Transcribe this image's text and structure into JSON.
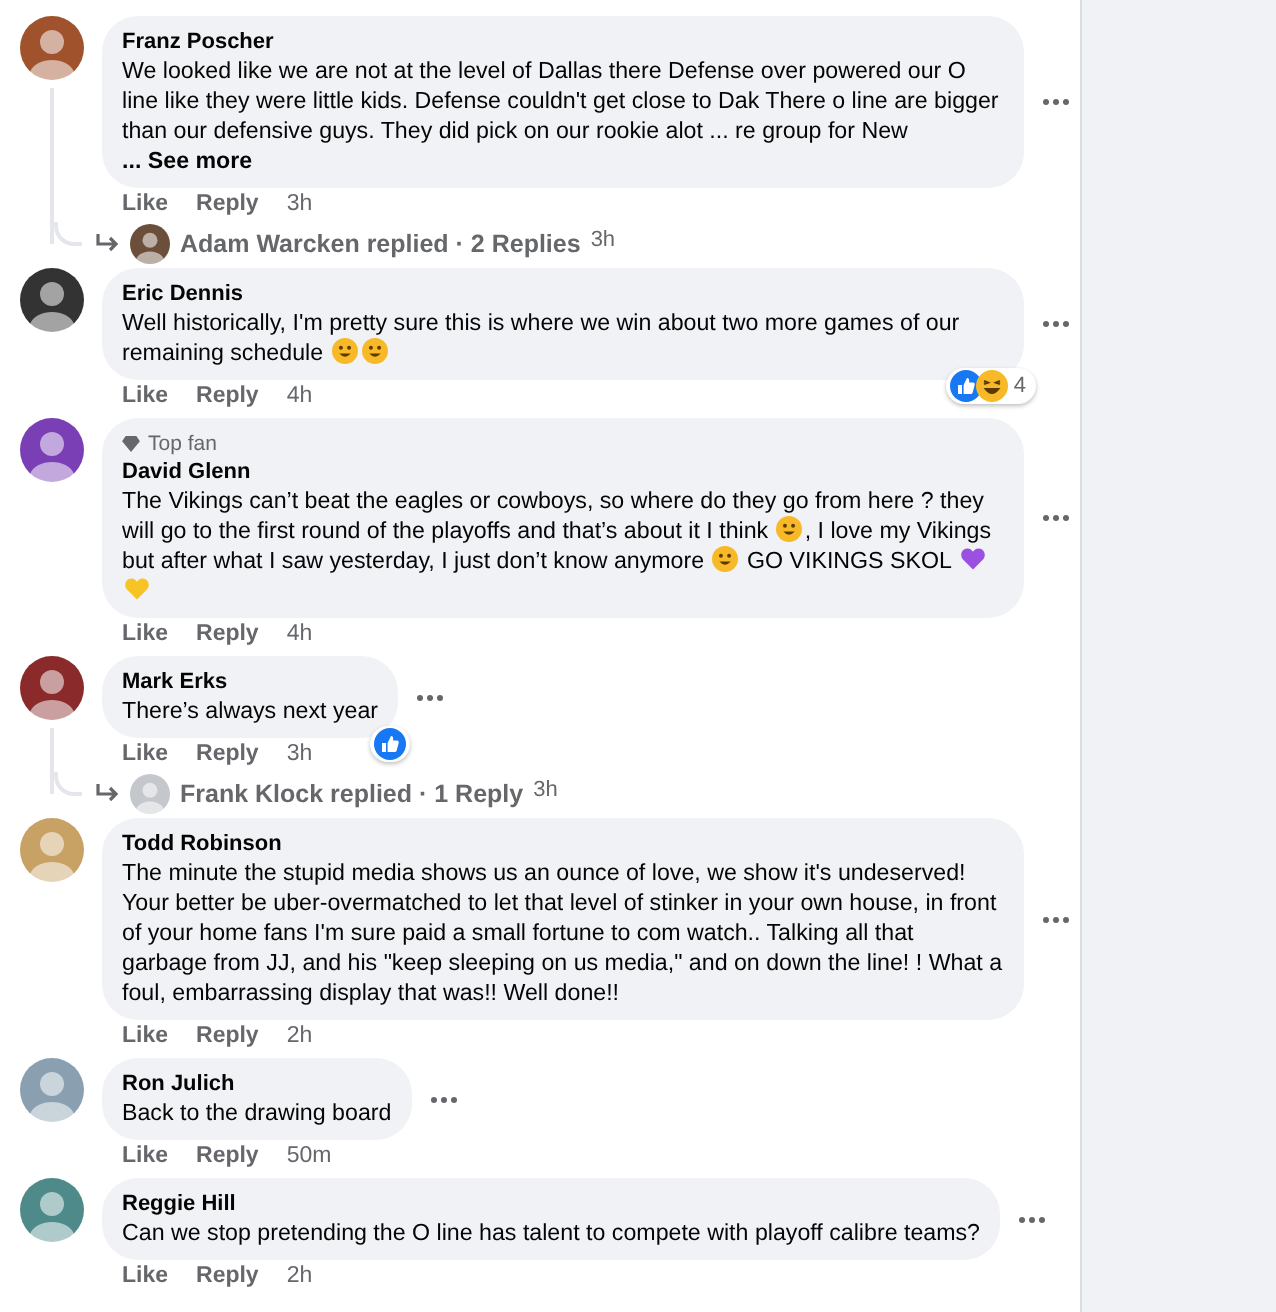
{
  "comments": [
    {
      "author": "Franz Poscher",
      "body": [
        {
          "kind": "text",
          "text": "We looked like we are not at the level of Dallas there Defense over powered our O line like they were little kids. Defense couldn't get close to Dak There o line are bigger than our defensive guys. They did pick on our rookie alot ... re group for New "
        }
      ],
      "see_more": "... See more",
      "actions": [
        "Like",
        "Reply"
      ],
      "time": "3h",
      "replies": {
        "name": "Adam Warcken replied · 2 Replies",
        "time": "3h"
      }
    },
    {
      "author": "Eric Dennis",
      "body": [
        {
          "kind": "text",
          "text": "Well historically, I'm pretty sure this is where we win about two more games of our remaining schedule "
        },
        {
          "kind": "face",
          "color": "#f7b928"
        },
        {
          "kind": "face",
          "color": "#f7b928"
        }
      ],
      "actions": [
        "Like",
        "Reply"
      ],
      "time": "4h",
      "reactions": {
        "icons": [
          {
            "kind": "like"
          },
          {
            "kind": "haha"
          }
        ],
        "count": "4"
      }
    },
    {
      "badge": "Top fan",
      "author": "David Glenn",
      "body": [
        {
          "kind": "text",
          "text": "The Vikings can’t beat the eagles or cowboys, so where do they go from here ? they will go to the first round of the playoffs and that’s about it I think "
        },
        {
          "kind": "face",
          "color": "#f7b928"
        },
        {
          "kind": "text",
          "text": ", I love my Vikings but after what I saw yesterday, I just don’t know anymore "
        },
        {
          "kind": "face",
          "color": "#f7b928"
        },
        {
          "kind": "text",
          "text": " GO VIKINGS SKOL "
        },
        {
          "kind": "heart",
          "color": "#9b51e0"
        },
        {
          "kind": "heart",
          "color": "#f7c325"
        }
      ],
      "actions": [
        "Like",
        "Reply"
      ],
      "time": "4h"
    },
    {
      "author": "Mark Erks",
      "body": [
        {
          "kind": "text",
          "text": "There’s always next year"
        }
      ],
      "actions": [
        "Like",
        "Reply"
      ],
      "time": "3h",
      "reactions": {
        "icons": [
          {
            "kind": "like"
          }
        ]
      },
      "replies": {
        "name": "Frank Klock replied · 1 Reply",
        "time": "3h"
      }
    },
    {
      "author": "Todd Robinson",
      "body": [
        {
          "kind": "text",
          "text": "The minute the stupid media shows us an ounce of love, we show it's undeserved! Your better be uber-overmatched to let that level of stinker in your own house, in front of your home fans I'm sure paid a small fortune to com watch.. Talking all that garbage from JJ, and his \"keep sleeping on us media,\" and on down the line! ! What a foul, embarrassing display that was!! Well done!!"
        }
      ],
      "actions": [
        "Like",
        "Reply"
      ],
      "time": "2h"
    },
    {
      "author": "Ron Julich",
      "body": [
        {
          "kind": "text",
          "text": "Back to the drawing board"
        }
      ],
      "actions": [
        "Like",
        "Reply"
      ],
      "time": "50m"
    },
    {
      "author": "Reggie Hill",
      "body": [
        {
          "kind": "text",
          "text": "Can we stop pretending the O line has talent to compete with playoff calibre teams?"
        }
      ],
      "actions": [
        "Like",
        "Reply"
      ],
      "time": "2h"
    }
  ]
}
